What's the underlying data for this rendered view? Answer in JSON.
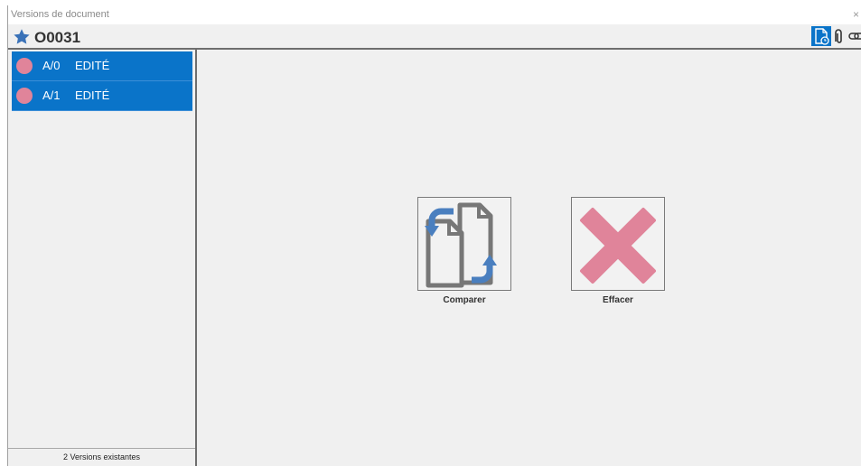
{
  "window": {
    "title": "Versions de document",
    "close_glyph": "×"
  },
  "header": {
    "star_icon": "star-icon",
    "document_number": "O0031",
    "toolbar": [
      {
        "icon": "document-clock-icon",
        "active": true
      },
      {
        "icon": "paperclip-icon",
        "active": false
      },
      {
        "icon": "link-icon",
        "active": false
      }
    ]
  },
  "versions": {
    "items": [
      {
        "code": "A/0",
        "status": "EDITÉ",
        "dot_color": "#e0849a"
      },
      {
        "code": "A/1",
        "status": "EDITÉ",
        "dot_color": "#e0849a"
      }
    ],
    "footer": "2 Versions existantes"
  },
  "actions": {
    "compare_label": "Comparer",
    "delete_label": "Effacer"
  },
  "colors": {
    "accent": "#0a74c9",
    "delete_pink": "#e0849a",
    "compare_blue": "#4a7fbf"
  }
}
